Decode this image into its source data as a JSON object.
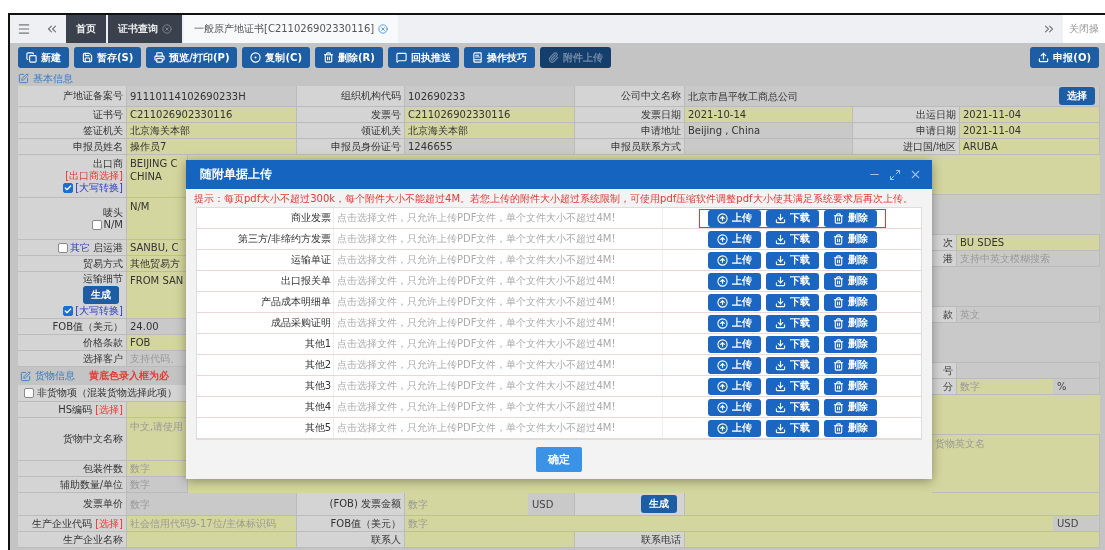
{
  "tab_bar": {
    "tabs": [
      {
        "label": "首页",
        "selected": false,
        "closable": false
      },
      {
        "label": "证书查询",
        "selected": false,
        "closable": true
      },
      {
        "label": "一般原产地证书[C211026902330116]",
        "selected": true,
        "closable": true
      }
    ],
    "right_label": "关闭操"
  },
  "toolbar": {
    "buttons": [
      {
        "label": "新建",
        "active": false
      },
      {
        "label": "暂存(S)",
        "active": false
      },
      {
        "label": "预览/打印(P)",
        "active": false
      },
      {
        "label": "复制(C)",
        "active": false
      },
      {
        "label": "删除(R)",
        "active": false
      },
      {
        "label": "回执推送",
        "active": false
      },
      {
        "label": "操作技巧",
        "active": false
      },
      {
        "label": "附件上传",
        "active": true
      }
    ],
    "submit": {
      "label": "申报(O)"
    }
  },
  "basic_info": {
    "title": "基本信息",
    "rows": [
      [
        {
          "label": "产地证备案号",
          "value": "91110114102690233H",
          "required": false
        },
        {
          "label": "组织机构代码",
          "value": "102690233",
          "required": false
        },
        {
          "label": "公司中文名称",
          "value": "北京市昌平牧工商总公司",
          "required": false,
          "action": "选择"
        }
      ],
      [
        {
          "label": "证书号",
          "value": "C211026902330116",
          "required": true
        },
        {
          "label": "发票号",
          "value": "C211026902330116",
          "required": true
        },
        {
          "label": "发票日期",
          "value": "2021-10-14",
          "required": true
        },
        {
          "label": "出运日期",
          "value": "2021-11-04",
          "required": true
        }
      ],
      [
        {
          "label": "签证机关",
          "value": "北京海关本部",
          "required": true
        },
        {
          "label": "领证机关",
          "value": "北京海关本部",
          "required": true
        },
        {
          "label": "申请地址",
          "value": "Beijing , China",
          "required": false
        },
        {
          "label": "申请日期",
          "value": "2021-11-04",
          "required": true
        }
      ],
      [
        {
          "label": "申报员姓名",
          "value": "操作员7",
          "required": true
        },
        {
          "label": "申报员身份证号",
          "value": "1246655",
          "required": false
        },
        {
          "label": "申报员联系方式",
          "required": false
        },
        {
          "label": "进口国/地区",
          "value": "ARUBA",
          "required": true
        }
      ]
    ]
  },
  "exporter_rows": [
    {
      "kind": "textarea",
      "label": "出口商",
      "link": "[出口商选择]",
      "option": {
        "label": "[大写转换]",
        "checked": true,
        "kind": "link"
      },
      "value_lines": [
        "BEIJING C",
        "CHINA"
      ],
      "required": true
    },
    {
      "kind": "textarea",
      "label": "唛头",
      "option": {
        "label": "N/M",
        "checked": false,
        "kind": "plain"
      },
      "value_lines": [
        "N/M"
      ],
      "required": true
    },
    {
      "kind": "text",
      "label": "启运港",
      "option": {
        "label": "其它",
        "checked": false,
        "kind": "link"
      },
      "value": "SANBU, C",
      "required": true
    },
    {
      "kind": "text",
      "label": "贸易方式",
      "value": "其他贸易方",
      "required": true
    },
    {
      "kind": "textarea",
      "label": "运输细节",
      "action": "生成",
      "option": {
        "label": "[大写转换]",
        "checked": true,
        "kind": "link"
      },
      "value_lines": [
        "FROM SAN"
      ],
      "required": true
    },
    {
      "kind": "text",
      "label": "FOB值（美元）",
      "value": "24.00",
      "required": false
    },
    {
      "kind": "text",
      "label": "价格条款",
      "value": "FOB",
      "required": true
    },
    {
      "kind": "text",
      "label": "选择客户",
      "placeholder": "支持代码、",
      "required": false
    }
  ],
  "goods_info": {
    "title": "货物信息",
    "note": "黄底色录入框为必",
    "non_goods": {
      "label": "非货物项（混装货物选择此项）",
      "checked": false
    },
    "rows": [
      {
        "kind": "text",
        "label": "HS编码",
        "link": "[选择]",
        "required": true
      },
      {
        "kind": "textarea",
        "label": "货物中文名称",
        "placeholder": "中文,请使用",
        "required": true
      },
      {
        "kind": "text",
        "label": "包装件数",
        "placeholder": "数字",
        "required": true
      },
      {
        "kind": "text",
        "label": "辅助数量/单位",
        "placeholder": "数字",
        "required": false
      }
    ]
  },
  "side_column": [
    {
      "kind": "block",
      "required": true
    },
    {
      "kind": "block",
      "required": false
    },
    {
      "kind": "field",
      "label": "次",
      "value": "BU SDES",
      "required": true
    },
    {
      "kind": "field",
      "label": "港",
      "placeholder": "支持中英文模糊搜索",
      "required": false
    },
    {
      "kind": "block",
      "required": false
    },
    {
      "kind": "field",
      "label": "款",
      "placeholder": "英文",
      "required": false
    },
    {
      "kind": "block",
      "required": false
    },
    {
      "kind": "field",
      "label": "号",
      "required": false
    },
    {
      "kind": "field",
      "label": "分",
      "placeholder": "数字",
      "unit": "%",
      "required": true
    },
    {
      "kind": "block",
      "required": true
    },
    {
      "kind": "tall",
      "placeholder": "货物英文名",
      "required": true
    }
  ],
  "bottom_rows": [
    [
      {
        "label": "发票单价",
        "placeholder": "数字",
        "required": false
      },
      {
        "label": "(FOB) 发票金额",
        "placeholder": "数字",
        "unit": "USD",
        "required": true
      },
      {
        "action": "生成",
        "required": true
      }
    ],
    [
      {
        "label": "生产企业代码",
        "link": "[选择]",
        "placeholder": "社会信用代码9-17位/主体标识码",
        "required": true
      },
      {
        "label": "FOB值（美元）",
        "placeholder": "数字",
        "unit": "USD",
        "required": true
      }
    ],
    [
      {
        "label": "生产企业名称",
        "required": true
      },
      {
        "label": "联系人",
        "required": true
      },
      {
        "label": "联系电话",
        "required": true
      }
    ]
  ],
  "dialog": {
    "title": "随附单据上传",
    "hint": "提示：每页pdf大小不超过300k，每个附件大小不能超过4M。若您上传的附件大小超过系统限制，可使用pdf压缩软件调整pdf大小使其满足系统要求后再次上传。",
    "rows": [
      {
        "label": "商业发票",
        "placeholder": "点击选择文件，只允许上传PDF文件，单个文件大小不超过4M!",
        "highlighted": true,
        "buttons": [
          "上传",
          "下载",
          "删除"
        ]
      },
      {
        "label": "第三方/非缔约方发票",
        "placeholder": "点击选择文件，只允许上传PDF文件，单个文件大小不超过4M!",
        "highlighted": false,
        "buttons": [
          "上传",
          "下载",
          "删除"
        ]
      },
      {
        "label": "运输单证",
        "placeholder": "点击选择文件，只允许上传PDF文件，单个文件大小不超过4M!",
        "highlighted": false,
        "buttons": [
          "上传",
          "下载",
          "删除"
        ]
      },
      {
        "label": "出口报关单",
        "placeholder": "点击选择文件，只允许上传PDF文件，单个文件大小不超过4M!",
        "highlighted": false,
        "buttons": [
          "上传",
          "下载",
          "删除"
        ]
      },
      {
        "label": "产品成本明细单",
        "placeholder": "点击选择文件，只允许上传PDF文件，单个文件大小不超过4M!",
        "highlighted": false,
        "buttons": [
          "上传",
          "下载",
          "删除"
        ]
      },
      {
        "label": "成品采购证明",
        "placeholder": "点击选择文件，只允许上传PDF文件，单个文件大小不超过4M!",
        "highlighted": false,
        "buttons": [
          "上传",
          "下载",
          "删除"
        ]
      },
      {
        "label": "其他1",
        "placeholder": "点击选择文件，只允许上传PDF文件，单个文件大小不超过4M!",
        "highlighted": false,
        "buttons": [
          "上传",
          "下载",
          "删除"
        ]
      },
      {
        "label": "其他2",
        "placeholder": "点击选择文件，只允许上传PDF文件，单个文件大小不超过4M!",
        "highlighted": false,
        "buttons": [
          "上传",
          "下载",
          "删除"
        ]
      },
      {
        "label": "其他3",
        "placeholder": "点击选择文件，只允许上传PDF文件，单个文件大小不超过4M!",
        "highlighted": false,
        "buttons": [
          "上传",
          "下载",
          "删除"
        ]
      },
      {
        "label": "其他4",
        "placeholder": "点击选择文件，只允许上传PDF文件，单个文件大小不超过4M!",
        "highlighted": false,
        "buttons": [
          "上传",
          "下载",
          "删除"
        ]
      },
      {
        "label": "其他5",
        "placeholder": "点击选择文件，只允许上传PDF文件，单个文件大小不超过4M!",
        "highlighted": false,
        "buttons": [
          "上传",
          "下载",
          "删除"
        ]
      }
    ],
    "confirm": "确定"
  }
}
